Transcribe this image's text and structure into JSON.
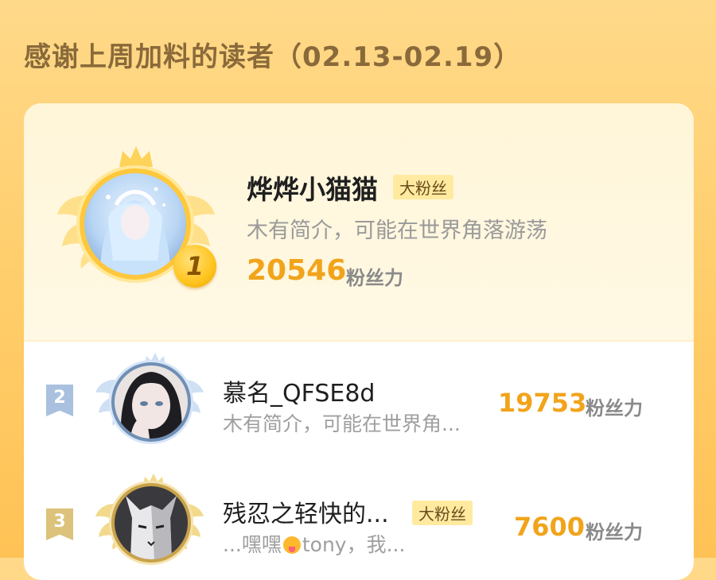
{
  "header": {
    "title": "感谢上周加料的读者（02.13-02.19）"
  },
  "top1": {
    "rank": "1",
    "name": "烨烨小猫猫",
    "badge": "大粉丝",
    "bio": "木有简介，可能在世界角落游荡",
    "score": "20546",
    "score_unit": "粉丝力"
  },
  "rows": [
    {
      "rank": "2",
      "name": "慕名_QFSE8d",
      "bio": "木有简介，可能在世界角...",
      "score": "19753",
      "score_unit": "粉丝力",
      "rank_color": "#a9c1de"
    },
    {
      "rank": "3",
      "name": "残忍之轻快的...",
      "badge": "大粉丝",
      "bio_prefix": "...嘿嘿",
      "bio_suffix": "tony，我...",
      "score": "7600",
      "score_unit": "粉丝力",
      "rank_color": "#dcc27a"
    }
  ],
  "colors": {
    "accent": "#f1a41b",
    "background": "#ffcf6e",
    "title": "#8a6a3a"
  }
}
